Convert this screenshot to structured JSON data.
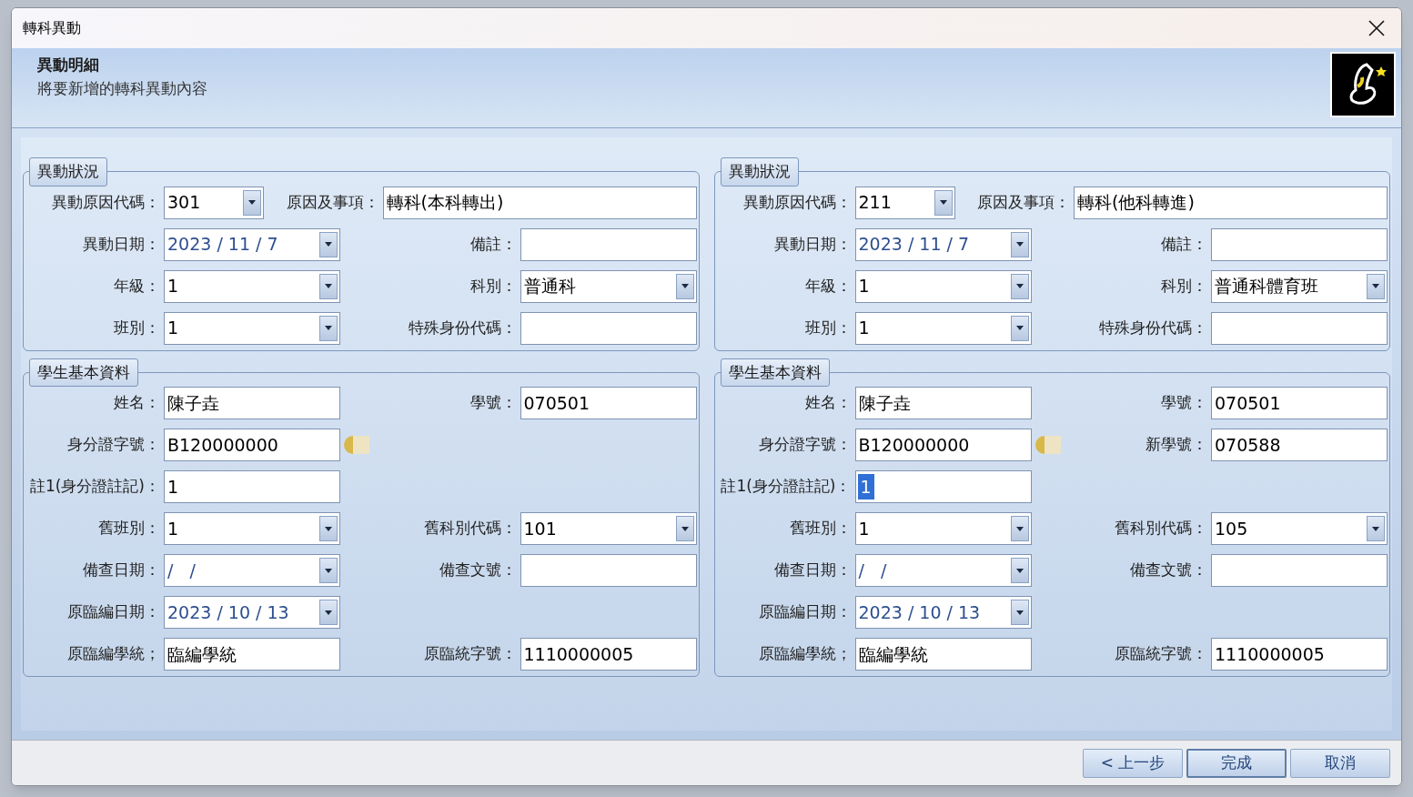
{
  "window": {
    "title": "轉科異動"
  },
  "header": {
    "title": "異動明細",
    "subtitle": "將要新增的轉科異動內容"
  },
  "panels": [
    {
      "status": {
        "title": "異動狀況",
        "rows": [
          [
            {
              "label": "異動原因代碼：",
              "kind": "code_combo",
              "value": "301"
            },
            {
              "label": "原因及事項：",
              "kind": "long_text",
              "value": "轉科(本科轉出)"
            }
          ],
          [
            {
              "label": "異動日期：",
              "kind": "date",
              "value": "2023 / 11 / 7"
            },
            {
              "label": "備註：",
              "kind": "text"
            }
          ],
          [
            {
              "label": "年級：",
              "kind": "combo",
              "value": "1"
            },
            {
              "label": "科別：",
              "kind": "combo",
              "value": "普通科"
            }
          ],
          [
            {
              "label": "班別：",
              "kind": "combo",
              "value": "1"
            },
            {
              "label": "特殊身份代碼：",
              "kind": "text"
            }
          ]
        ]
      },
      "student": {
        "title": "學生基本資料",
        "rows": [
          [
            {
              "label": "姓名：",
              "kind": "text",
              "value": "陳子垚"
            },
            {
              "label": "學號：",
              "kind": "text",
              "value": "070501"
            }
          ],
          [
            {
              "label": "身分證字號：",
              "kind": "id_text",
              "value": "B120000000"
            }
          ],
          [
            {
              "label": "註1(身分證註記)：",
              "kind": "text",
              "value": "1",
              "highlighted": false
            }
          ],
          [
            {
              "label": "舊班別：",
              "kind": "combo",
              "value": "1"
            },
            {
              "label": "舊科別代碼：",
              "kind": "combo",
              "value": "101"
            }
          ],
          [
            {
              "label": "備查日期：",
              "kind": "date",
              "value": "/   /"
            },
            {
              "label": "備查文號：",
              "kind": "text"
            }
          ],
          [
            {
              "label": "原臨編日期：",
              "kind": "date",
              "value": "2023 / 10 / 13"
            }
          ],
          [
            {
              "label": "原臨編學統；",
              "kind": "text",
              "value": "臨編學統"
            },
            {
              "label": "原臨統字號：",
              "kind": "text",
              "value": "1110000005"
            }
          ]
        ]
      }
    },
    {
      "status": {
        "title": "異動狀況",
        "rows": [
          [
            {
              "label": "異動原因代碼：",
              "kind": "code_combo",
              "value": "211"
            },
            {
              "label": "原因及事項：",
              "kind": "long_text",
              "value": "轉科(他科轉進)"
            }
          ],
          [
            {
              "label": "異動日期：",
              "kind": "date",
              "value": "2023 / 11 / 7"
            },
            {
              "label": "備註：",
              "kind": "text"
            }
          ],
          [
            {
              "label": "年級：",
              "kind": "combo",
              "value": "1"
            },
            {
              "label": "科別：",
              "kind": "combo",
              "value": "普通科體育班"
            }
          ],
          [
            {
              "label": "班別：",
              "kind": "combo",
              "value": "1"
            },
            {
              "label": "特殊身份代碼：",
              "kind": "text"
            }
          ]
        ]
      },
      "student": {
        "title": "學生基本資料",
        "rows": [
          [
            {
              "label": "姓名：",
              "kind": "text",
              "value": "陳子垚"
            },
            {
              "label": "學號：",
              "kind": "text",
              "value": "070501"
            }
          ],
          [
            {
              "label": "身分證字號：",
              "kind": "id_text",
              "value": "B120000000"
            },
            {
              "label": "新學號：",
              "kind": "text",
              "value": "070588"
            }
          ],
          [
            {
              "label": "註1(身分證註記)：",
              "kind": "text",
              "value": "1",
              "highlighted": true
            }
          ],
          [
            {
              "label": "舊班別：",
              "kind": "combo",
              "value": "1"
            },
            {
              "label": "舊科別代碼：",
              "kind": "combo",
              "value": "105"
            }
          ],
          [
            {
              "label": "備查日期：",
              "kind": "date",
              "value": "/   /"
            },
            {
              "label": "備查文號：",
              "kind": "text"
            }
          ],
          [
            {
              "label": "原臨編日期：",
              "kind": "date",
              "value": "2023 / 10 / 13"
            }
          ],
          [
            {
              "label": "原臨編學統；",
              "kind": "text",
              "value": "臨編學統"
            },
            {
              "label": "原臨統字號：",
              "kind": "text",
              "value": "1110000005"
            }
          ]
        ]
      }
    }
  ],
  "buttons": [
    {
      "label": "< 上一步",
      "default": false
    },
    {
      "label": "完成",
      "default": true
    },
    {
      "label": "取消",
      "default": false
    }
  ]
}
